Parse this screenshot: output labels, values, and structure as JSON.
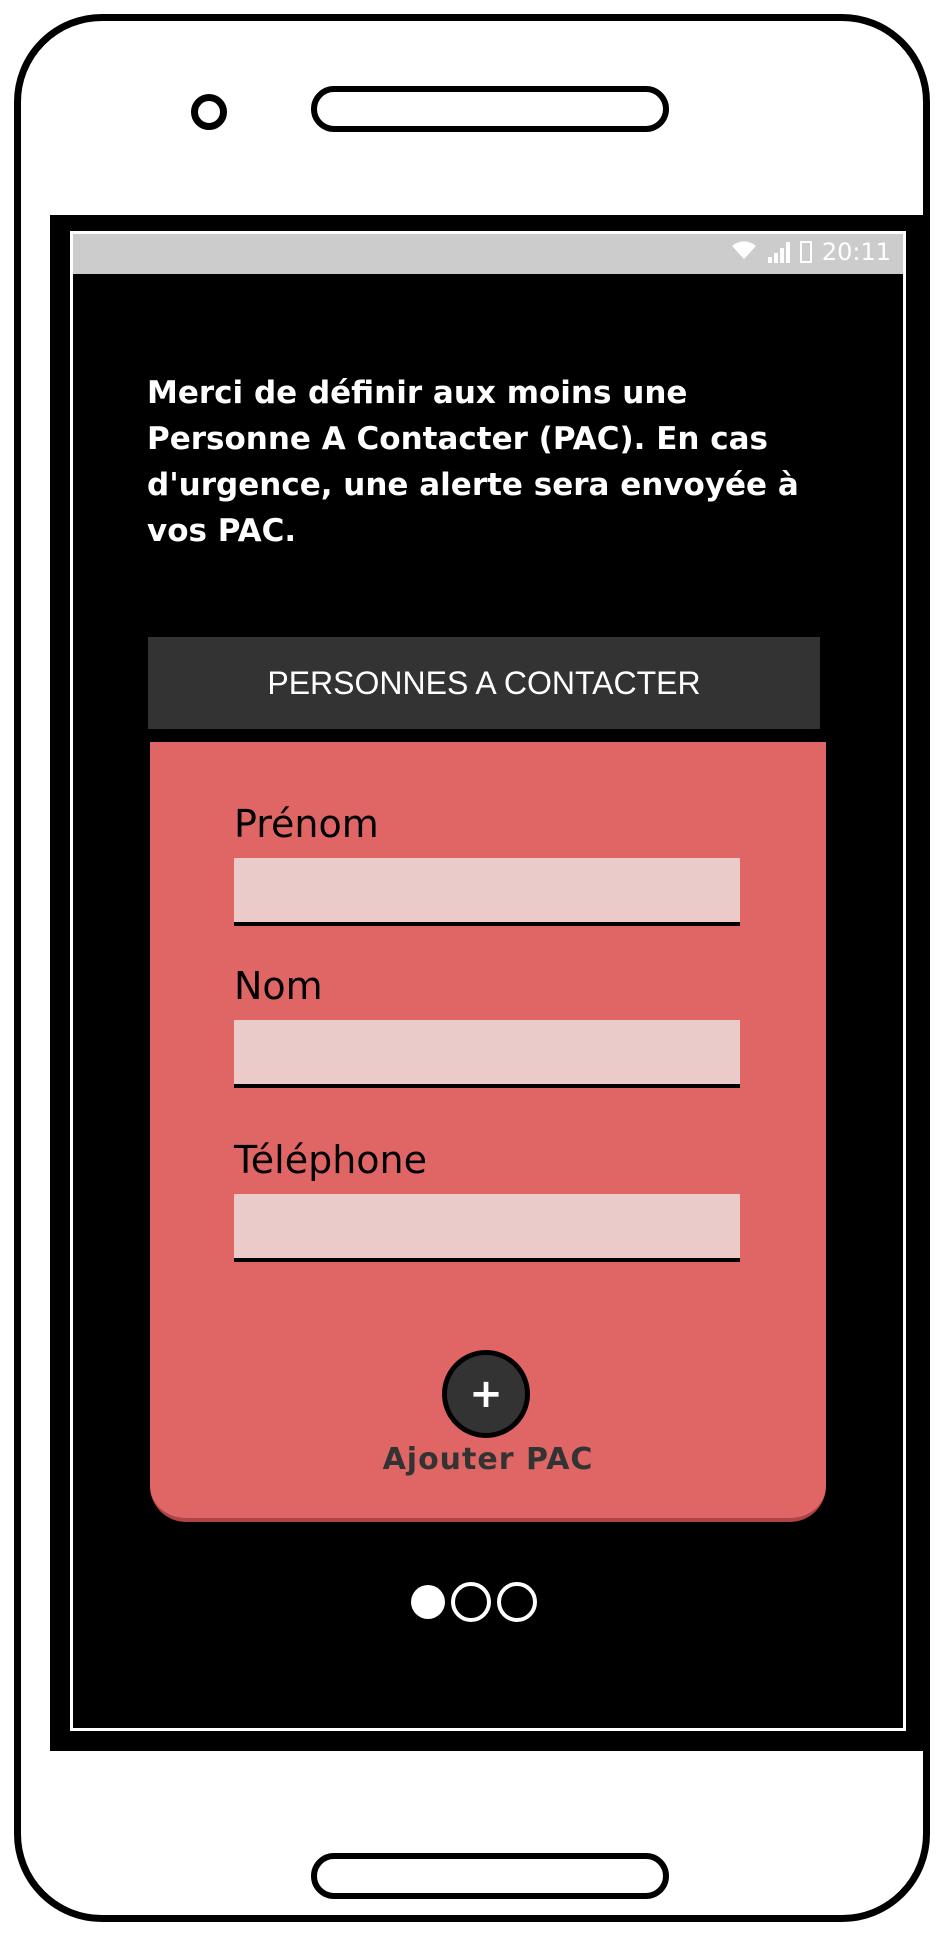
{
  "status_bar": {
    "time": "20:11",
    "icons": [
      "wifi-icon",
      "signal-icon",
      "battery-icon"
    ]
  },
  "intro_text": "Merci de définir aux moins une Personne A Contacter (PAC). En cas d'urgence, une alerte sera envoyée à vos PAC.",
  "card": {
    "header": "PERSONNES A CONTACTER",
    "fields": [
      {
        "label": "Prénom",
        "value": "",
        "placeholder": ""
      },
      {
        "label": "Nom",
        "value": "",
        "placeholder": ""
      },
      {
        "label": "Téléphone",
        "value": "",
        "placeholder": ""
      }
    ],
    "add_button": {
      "icon": "plus-icon",
      "label": "Ajouter PAC"
    }
  },
  "pager": {
    "total": 3,
    "active_index": 0
  },
  "colors": {
    "screen_background": "#000000",
    "status_bar": "#cccccc",
    "card_header": "#333333",
    "card_body": "#e06666",
    "input_background": "#ebcaca"
  }
}
